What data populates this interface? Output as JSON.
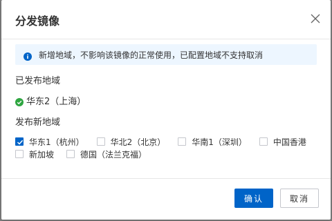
{
  "dialog": {
    "title": "分发镜像",
    "close_icon": "close-icon"
  },
  "notice": {
    "icon": "info-icon",
    "text": "新增地域，不影响该镜像的正常使用，已配置地域不支持取消"
  },
  "published_section": {
    "label": "已发布地域",
    "regions": [
      {
        "name": "华东2（上海）",
        "icon": "check-circle-icon"
      }
    ]
  },
  "new_section": {
    "label": "发布新地域",
    "regions": [
      {
        "name": "华东1（杭州）",
        "checked": true
      },
      {
        "name": "华北2（北京）",
        "checked": false
      },
      {
        "name": "华南1（深圳）",
        "checked": false
      },
      {
        "name": "中国香港",
        "checked": false
      },
      {
        "name": "新加坡",
        "checked": false
      },
      {
        "name": "德国（法兰克福）",
        "checked": false
      }
    ]
  },
  "footer": {
    "confirm_label": "确认",
    "cancel_label": "取消"
  },
  "colors": {
    "primary": "#0064c8",
    "success": "#2fa641",
    "notice_bg": "#edf6ff",
    "info": "#0064c8"
  }
}
